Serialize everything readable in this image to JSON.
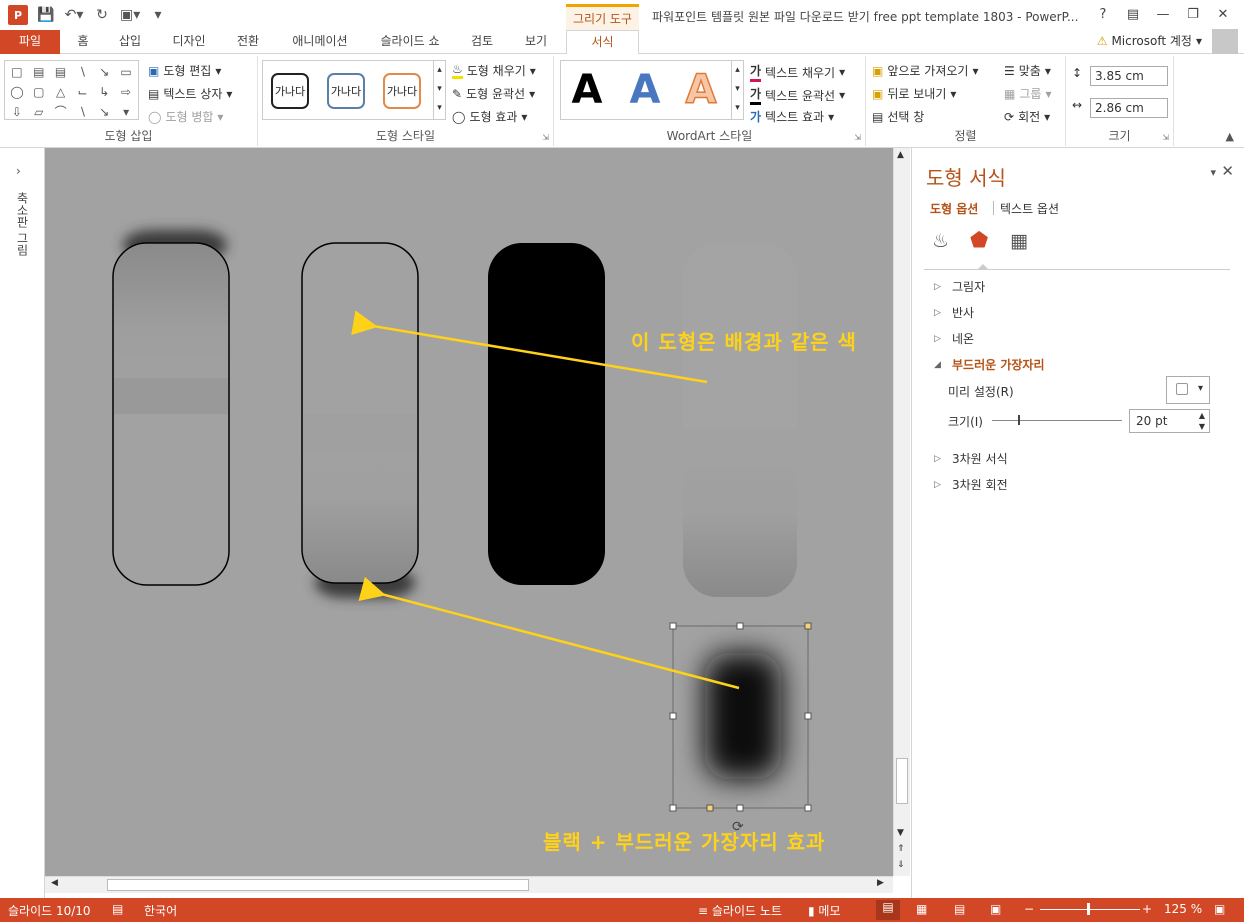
{
  "title_bar": {
    "context_tool": "그리기 도구",
    "window_title": "파워포인트 템플릿 원본 파일 다운로드 받기 free ppt template 1803 - PowerP...",
    "help": "?",
    "logo_text": "P"
  },
  "tabs": [
    "파일",
    "홈",
    "삽입",
    "디자인",
    "전환",
    "애니메이션",
    "슬라이드 쇼",
    "검토",
    "보기",
    "서식"
  ],
  "account": "Microsoft 계정",
  "ribbon": {
    "insert_shapes": {
      "edit_shape": "도형 편집",
      "text_box": "텍스트 상자",
      "merge_shapes": "도형 병합",
      "label": "도형 삽입"
    },
    "shape_styles": {
      "swatch": "가나다",
      "fill": "도형 채우기",
      "outline": "도형 윤곽선",
      "effects": "도형 효과",
      "label": "도형 스타일"
    },
    "wordart": {
      "letter": "A",
      "text_fill": "텍스트 채우기",
      "text_outline": "텍스트 윤곽선",
      "text_effects": "텍스트 효과",
      "label": "WordArt 스타일"
    },
    "arrange": {
      "bring_forward": "앞으로 가져오기",
      "send_backward": "뒤로 보내기",
      "selection_pane": "선택 창",
      "align": "맞춤",
      "group": "그룹",
      "rotate": "회전",
      "label": "정렬"
    },
    "size": {
      "height": "3.85 cm",
      "width": "2.86 cm",
      "label": "크기"
    }
  },
  "left_pane": {
    "label": "축소판 그림"
  },
  "canvas": {
    "annotation_top": "이 도형은 배경과 같은 색",
    "annotation_bottom": "블랙 + 부드러운 가장자리 효과"
  },
  "format_pane": {
    "title": "도형 서식",
    "tab_shape": "도형 옵션",
    "tab_text": "텍스트 옵션",
    "sections": {
      "shadow": "그림자",
      "reflection": "반사",
      "glow": "네온",
      "soft_edges": "부드러운 가장자리",
      "format_3d": "3차원 서식",
      "rotation_3d": "3차원 회전"
    },
    "preset_label": "미리 설정(R)",
    "size_label": "크기(I)",
    "size_value": "20 pt",
    "size_slider_fraction": 0.2
  },
  "status_bar": {
    "slide": "슬라이드 10/10",
    "language": "한국어",
    "notes": "슬라이드 노트",
    "comments": "메모",
    "zoom": "125 %"
  },
  "colors": {
    "accent": "#d24726",
    "canvas": "#a2a2a2",
    "annotation": "#ffd21a",
    "context": "#b55318"
  }
}
